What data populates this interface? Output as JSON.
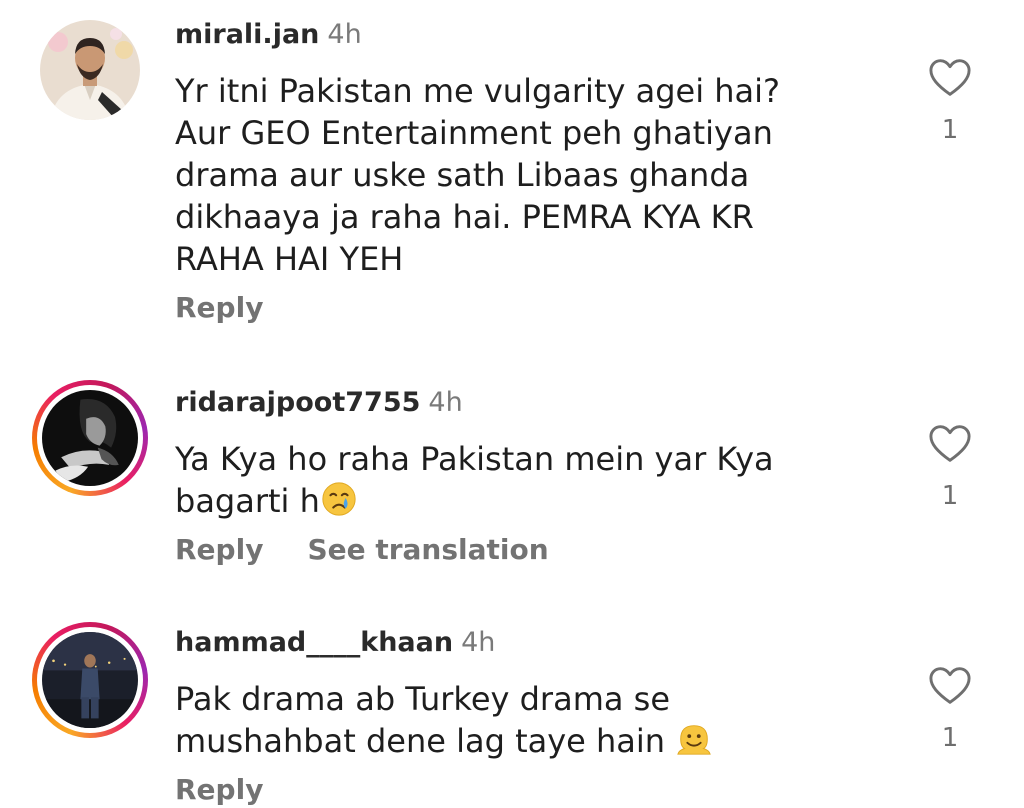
{
  "comments": [
    {
      "username": "mirali.jan",
      "time": "4h",
      "text": "Yr itni Pakistan me vulgarity agei hai? Aur GEO Entertainment peh ghatiyan drama aur uske sath Libaas ghanda dikhaaya ja raha hai. PEMRA KYA KR RAHA HAI YEH",
      "reply_label": "Reply",
      "like_count": "1",
      "has_story_ring": false
    },
    {
      "username": "ridarajpoot7755",
      "time": "4h",
      "text": "Ya Kya ho raha Pakistan mein yar  Kya bagarti h",
      "emoji": "crying-face",
      "reply_label": "Reply",
      "translation_label": "See translation",
      "like_count": "1",
      "has_story_ring": true
    },
    {
      "username": "hammad____khaan",
      "time": "4h",
      "text": "Pak drama ab Turkey drama se mushahbat dene lag taye hain ",
      "emoji": "melting-face",
      "reply_label": "Reply",
      "like_count": "1",
      "has_story_ring": true
    }
  ],
  "icons": {
    "like": "heart-outline-icon"
  }
}
